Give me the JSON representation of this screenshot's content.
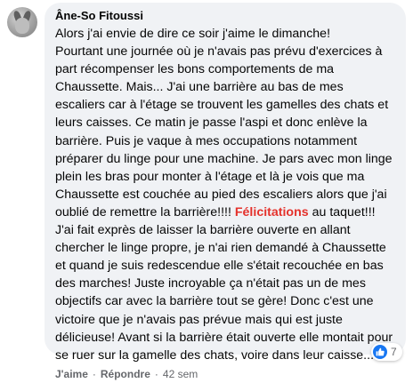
{
  "comment": {
    "author": "Âne-So Fitoussi",
    "body_before": "Alors j'ai envie de dire ce soir j'aime le dimanche!\nPourtant une journée où je n'avais pas prévu d'exercices à part récompenser les bons comportements de ma Chaussette. Mais... J'ai une barrière au bas de mes escaliers car à l'étage se trouvent les gamelles des chats et leurs caisses. Ce matin je passe l'aspi et donc enlève la barrière. Puis je vaque à mes occupations notamment préparer du linge pour une machine. Je pars avec mon linge plein les bras pour monter à l'étage et là je vois que ma Chaussette est couchée au pied des escaliers alors que j'ai oublié de remettre la barrière!!!! ",
    "body_highlight": "Félicitations",
    "body_after": " au taquet!!! J'ai fait exprès de laisser la barrière ouverte en allant chercher le linge propre, je n'ai rien demandé à Chaussette et quand je suis redescendue elle s'était recouchée en bas des marches! Juste incroyable ça n'était pas un de mes objectifs car avec la barrière tout se gère! Donc c'est une victoire que je n'avais pas prévue mais qui est juste délicieuse! Avant si la barrière était ouverte elle montait pour se ruer sur la gamelle des chats, voire dans leur caisse...",
    "reaction_count": "7",
    "reaction_icon": "like-icon",
    "actions": {
      "like": "J'aime",
      "separator": "·",
      "reply": "Répondre",
      "time": "42 sem"
    }
  },
  "colors": {
    "bubble": "#f0f2f5",
    "highlight": "#e4312b",
    "like_blue": "#1877f2",
    "secondary_text": "#65676b"
  }
}
